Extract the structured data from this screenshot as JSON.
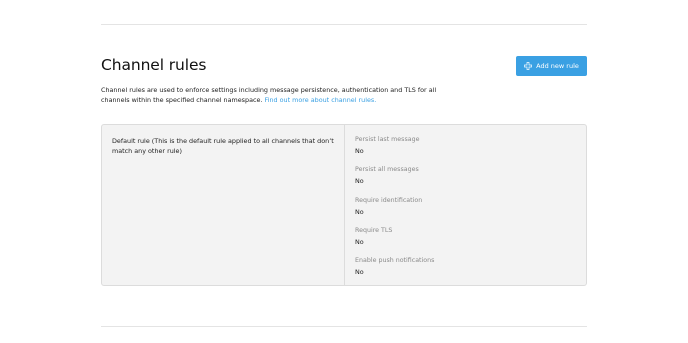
{
  "page": {
    "title": "Channel rules",
    "add_button_label": "Add new rule",
    "description": "Channel rules are used to enforce settings including message persistence, authentication and TLS for all channels within the specified channel namespace.",
    "description_link": "Find out more about channel rules."
  },
  "rule": {
    "name": "Default rule (This is the default rule applied to all channels that don’t match any other rule)",
    "settings": [
      {
        "label": "Persist last message",
        "value": "No"
      },
      {
        "label": "Persist all messages",
        "value": "No"
      },
      {
        "label": "Require identification",
        "value": "No"
      },
      {
        "label": "Require TLS",
        "value": "No"
      },
      {
        "label": "Enable push notifications",
        "value": "No"
      }
    ]
  },
  "colors": {
    "accent": "#3aa0e3",
    "panel_bg": "#f3f3f3",
    "muted_text": "#8a8a8a"
  }
}
